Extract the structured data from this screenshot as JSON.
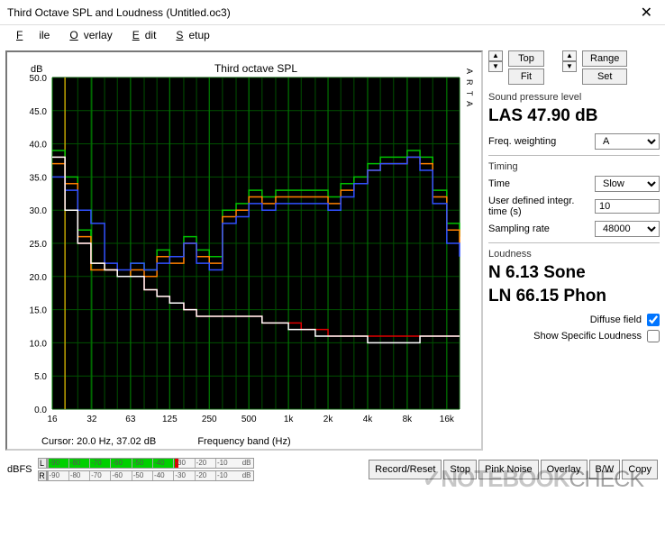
{
  "window": {
    "title": "Third Octave SPL and Loudness (Untitled.oc3)"
  },
  "menu": {
    "file": "File",
    "overlay": "Overlay",
    "edit": "Edit",
    "setup": "Setup"
  },
  "chart": {
    "ylabel": "dB",
    "title": "Third octave SPL",
    "xlabel": "Frequency band  (Hz)",
    "cursor": "Cursor:   20.0 Hz, 37.02 dB",
    "brand": "A R T A"
  },
  "toolbar": {
    "top": "Top",
    "fit": "Fit",
    "range": "Range",
    "set": "Set"
  },
  "spl": {
    "head": "Sound pressure level",
    "value": "LAS 47.90 dB"
  },
  "freqw": {
    "label": "Freq. weighting",
    "value": "A"
  },
  "timing": {
    "head": "Timing",
    "time_label": "Time",
    "time_value": "Slow",
    "udit_label": "User defined integr. time (s)",
    "udit_value": "10",
    "sr_label": "Sampling rate",
    "sr_value": "48000"
  },
  "loud": {
    "head": "Loudness",
    "sone": "N 6.13 Sone",
    "phon": "LN 66.15 Phon",
    "diffuse": "Diffuse field",
    "ssl": "Show Specific Loudness"
  },
  "meters": {
    "label": "dBFS",
    "L": "L",
    "R": "R",
    "ticks": [
      "-90",
      "-80",
      "-70",
      "-60",
      "-50",
      "-40",
      "-30",
      "-20",
      "-10"
    ],
    "end": "dB"
  },
  "buttons": {
    "record": "Record/Reset",
    "stop": "Stop",
    "pink": "Pink Noise",
    "overlay": "Overlay",
    "bw": "B/W",
    "copy": "Copy"
  },
  "chart_data": {
    "type": "line-step",
    "xlabel": "Frequency band (Hz)",
    "ylabel": "dB",
    "title": "Third octave SPL",
    "xtick_labels": [
      "16",
      "32",
      "63",
      "125",
      "250",
      "500",
      "1k",
      "2k",
      "4k",
      "8k",
      "16k"
    ],
    "xtick_values": [
      16,
      32,
      63,
      125,
      250,
      500,
      1000,
      2000,
      4000,
      8000,
      16000
    ],
    "ylim": [
      0,
      50
    ],
    "ytick_step": 5,
    "x_third_octave_bands_hz": [
      16,
      20,
      25,
      31.5,
      40,
      50,
      63,
      80,
      100,
      125,
      160,
      200,
      250,
      315,
      400,
      500,
      630,
      800,
      1000,
      1250,
      1600,
      2000,
      2500,
      3150,
      4000,
      5000,
      6300,
      8000,
      10000,
      12500,
      16000,
      20000
    ],
    "series": [
      {
        "name": "green",
        "color": "#00c000",
        "values": [
          39,
          35,
          27,
          22,
          21,
          20,
          22,
          21,
          24,
          23,
          26,
          24,
          23,
          30,
          31,
          33,
          32,
          33,
          33,
          33,
          33,
          32,
          34,
          35,
          37,
          38,
          38,
          39,
          38,
          33,
          28,
          26
        ]
      },
      {
        "name": "orange",
        "color": "#ff8000",
        "values": [
          37,
          34,
          26,
          21,
          21,
          20,
          21,
          20,
          23,
          22,
          25,
          23,
          22,
          29,
          30,
          32,
          31,
          32,
          32,
          32,
          32,
          31,
          33,
          34,
          36,
          37,
          37,
          38,
          37,
          32,
          27,
          25
        ]
      },
      {
        "name": "blue",
        "color": "#3050ff",
        "values": [
          35,
          33,
          30,
          28,
          22,
          21,
          22,
          21,
          22,
          23,
          25,
          22,
          21,
          28,
          29,
          31,
          30,
          31,
          31,
          31,
          31,
          30,
          32,
          34,
          36,
          37,
          37,
          38,
          36,
          31,
          25,
          23
        ]
      },
      {
        "name": "red",
        "color": "#e00000",
        "values": [
          38,
          30,
          25,
          22,
          21,
          20,
          20,
          18,
          17,
          16,
          15,
          14,
          14,
          14,
          14,
          14,
          13,
          13,
          13,
          12,
          12,
          11,
          11,
          11,
          11,
          11,
          11,
          11,
          11,
          11,
          11,
          11
        ]
      },
      {
        "name": "white",
        "color": "#ffffff",
        "values": [
          38,
          30,
          25,
          22,
          21,
          20,
          20,
          18,
          17,
          16,
          15,
          14,
          14,
          14,
          14,
          14,
          13,
          13,
          12,
          12,
          11,
          11,
          11,
          11,
          10,
          10,
          10,
          10,
          11,
          11,
          11,
          11
        ]
      }
    ]
  }
}
